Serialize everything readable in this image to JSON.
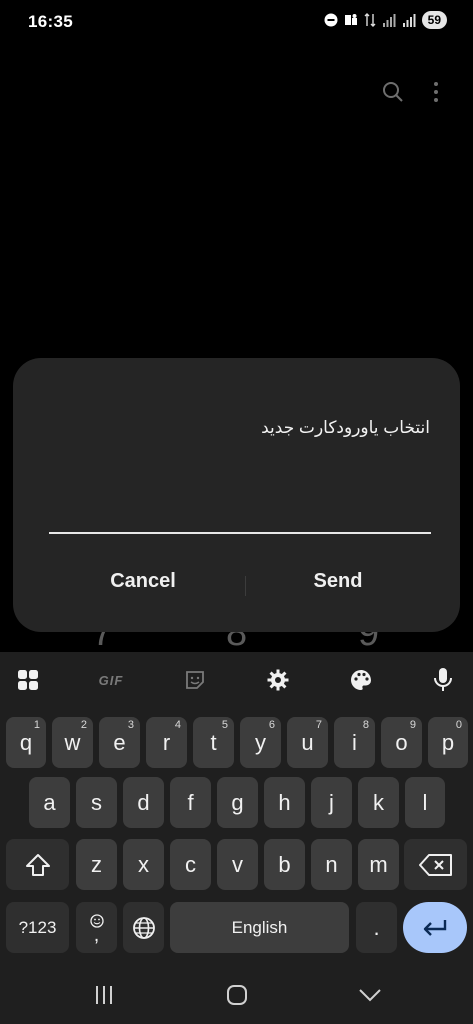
{
  "status_bar": {
    "time": "16:35",
    "battery": "59"
  },
  "background_digits": [
    "7",
    "8",
    "9"
  ],
  "dialog": {
    "title": "انتخاب یاورودکارت جدید",
    "input_value": "",
    "cancel_label": "Cancel",
    "send_label": "Send"
  },
  "keyboard": {
    "toolbar": {
      "gif_label": "GIF"
    },
    "row1": [
      {
        "label": "q",
        "hint": "1"
      },
      {
        "label": "w",
        "hint": "2"
      },
      {
        "label": "e",
        "hint": "3"
      },
      {
        "label": "r",
        "hint": "4"
      },
      {
        "label": "t",
        "hint": "5"
      },
      {
        "label": "y",
        "hint": "6"
      },
      {
        "label": "u",
        "hint": "7"
      },
      {
        "label": "i",
        "hint": "8"
      },
      {
        "label": "o",
        "hint": "9"
      },
      {
        "label": "p",
        "hint": "0"
      }
    ],
    "row2": [
      "a",
      "s",
      "d",
      "f",
      "g",
      "h",
      "j",
      "k",
      "l"
    ],
    "row3": [
      "z",
      "x",
      "c",
      "v",
      "b",
      "n",
      "m"
    ],
    "symbols_label": "?123",
    "comma_label": ",",
    "space_label": "English",
    "period_label": "."
  },
  "colors": {
    "enter_key": "#a8c7fa",
    "key": "#3d3d3d",
    "keyboard_bg": "#1f1f1f",
    "dialog_bg": "#252525"
  }
}
